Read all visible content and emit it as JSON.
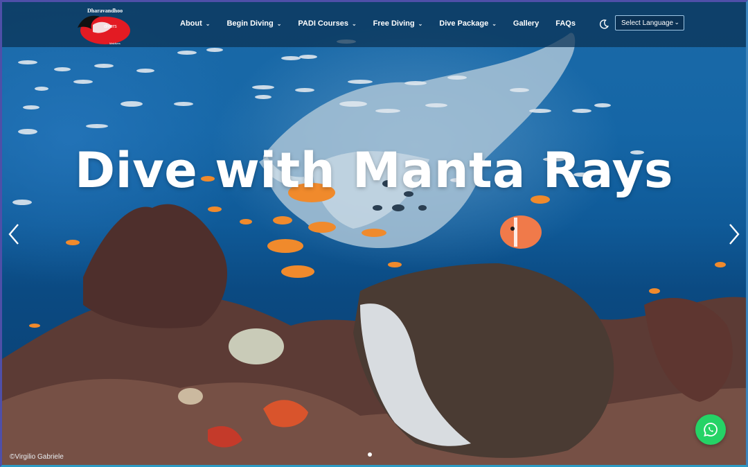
{
  "logo": {
    "brand_top": "Dharavandhoo",
    "brand_mid": "divers",
    "brand_bottom": "Maldives"
  },
  "nav": {
    "items": [
      {
        "label": "About",
        "has_dropdown": true
      },
      {
        "label": "Begin Diving",
        "has_dropdown": true
      },
      {
        "label": "PADI Courses",
        "has_dropdown": true
      },
      {
        "label": "Free Diving",
        "has_dropdown": true
      },
      {
        "label": "Dive Package",
        "has_dropdown": true
      },
      {
        "label": "Gallery",
        "has_dropdown": false
      },
      {
        "label": "FAQs",
        "has_dropdown": false
      }
    ],
    "dark_mode_icon": "moon-icon",
    "language_select": "Select Language"
  },
  "hero": {
    "title": "Dive with Manta Rays",
    "photo_credit": "©Virgilio Gabriele",
    "prev_icon": "chevron-left-icon",
    "next_icon": "chevron-right-icon",
    "slide_count_visible": 1
  },
  "whatsapp": {
    "icon": "whatsapp-icon",
    "color": "#25d366"
  },
  "colors": {
    "navbar_bg": "#0a3052",
    "ocean": "#1566a6",
    "white": "#ffffff"
  }
}
